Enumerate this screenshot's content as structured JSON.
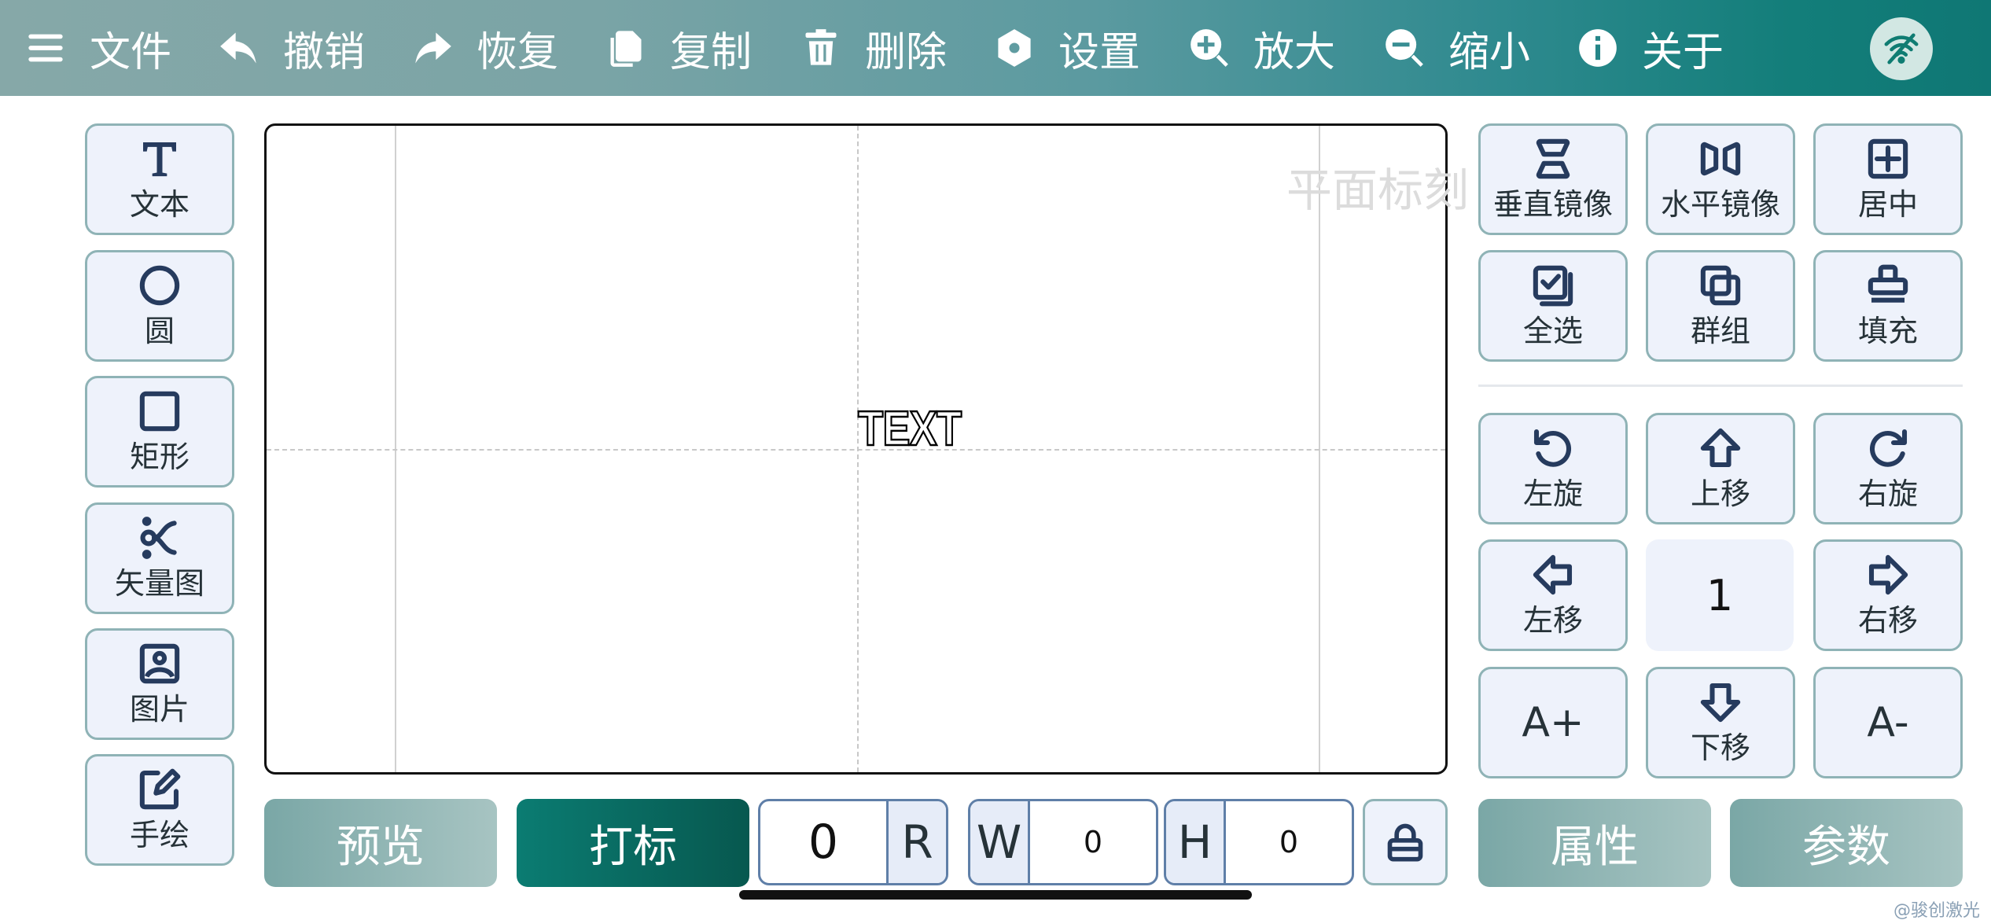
{
  "toolbar": {
    "items": [
      {
        "label": "文件",
        "icon": "menu-icon"
      },
      {
        "label": "撤销",
        "icon": "undo-icon"
      },
      {
        "label": "恢复",
        "icon": "redo-icon"
      },
      {
        "label": "复制",
        "icon": "copy-icon"
      },
      {
        "label": "删除",
        "icon": "trash-icon"
      },
      {
        "label": "设置",
        "icon": "settings-icon"
      },
      {
        "label": "放大",
        "icon": "zoom-in-icon"
      },
      {
        "label": "缩小",
        "icon": "zoom-out-icon"
      },
      {
        "label": "关于",
        "icon": "info-icon"
      }
    ],
    "avatar_icon": "wifi-off-icon"
  },
  "left_tools": [
    {
      "label": "文本",
      "icon": "text-icon"
    },
    {
      "label": "圆",
      "icon": "circle-icon"
    },
    {
      "label": "矩形",
      "icon": "rectangle-icon"
    },
    {
      "label": "矢量图",
      "icon": "vector-icon"
    },
    {
      "label": "图片",
      "icon": "image-icon"
    },
    {
      "label": "手绘",
      "icon": "draw-icon"
    }
  ],
  "canvas": {
    "object_text": "TEXT",
    "watermark": "平面标刻"
  },
  "right_tools": {
    "row1": [
      {
        "label": "垂直镜像",
        "icon": "flip-vertical-icon"
      },
      {
        "label": "水平镜像",
        "icon": "flip-horizontal-icon"
      },
      {
        "label": "居中",
        "icon": "center-icon"
      }
    ],
    "row2": [
      {
        "label": "全选",
        "icon": "select-all-icon"
      },
      {
        "label": "群组",
        "icon": "group-icon"
      },
      {
        "label": "填充",
        "icon": "fill-icon"
      }
    ],
    "rotate_left": {
      "label": "左旋",
      "icon": "rotate-left-icon"
    },
    "move_up": {
      "label": "上移",
      "icon": "arrow-up-icon"
    },
    "rotate_right": {
      "label": "右旋",
      "icon": "rotate-right-icon"
    },
    "move_left": {
      "label": "左移",
      "icon": "arrow-left-icon"
    },
    "step": "1",
    "move_right": {
      "label": "右移",
      "icon": "arrow-right-icon"
    },
    "font_increase": "A+",
    "move_down": {
      "label": "下移",
      "icon": "arrow-down-icon"
    },
    "font_decrease": "A-"
  },
  "bottom": {
    "preview": "预览",
    "mark": "打标",
    "rotation_value": "0",
    "rotation_label": "R",
    "width_label": "W",
    "width_value": "0",
    "height_label": "H",
    "height_value": "0",
    "lock_icon": "lock-icon",
    "properties": "属性",
    "parameters": "参数"
  },
  "credit": "@骏创激光",
  "colors": {
    "accent_dark": "#07584f",
    "tool_border": "#8fb3b6",
    "tool_bg": "#eef2fb",
    "icon_color": "#263b5e"
  }
}
